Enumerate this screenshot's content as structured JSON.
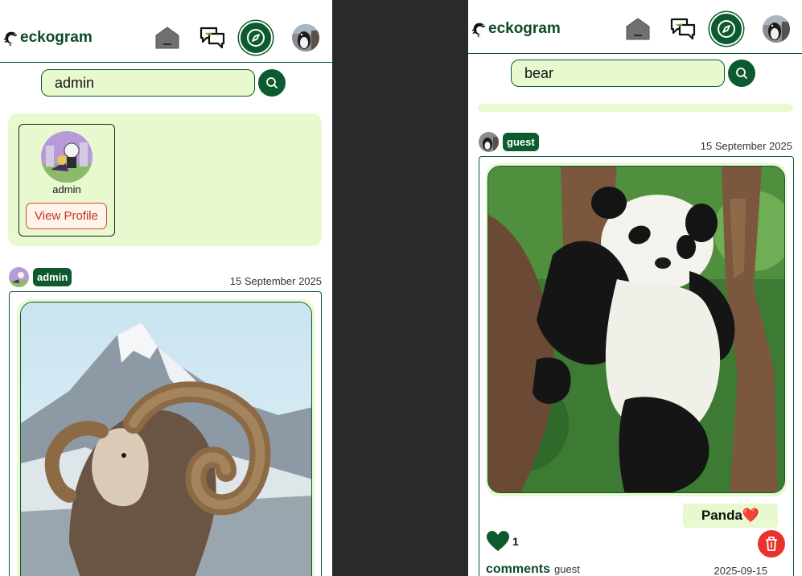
{
  "left": {
    "logo": "eckogram",
    "search": {
      "value": "admin"
    },
    "result_card": {
      "username": "admin",
      "button_label": "View Profile"
    },
    "post": {
      "username": "admin",
      "date": "15 September 2025"
    }
  },
  "right": {
    "logo": "eckogram",
    "search": {
      "value": "bear"
    },
    "post": {
      "username": "guest",
      "date": "15 September 2025",
      "caption": "Panda",
      "caption_emoji": "❤️",
      "like_count": "1",
      "comments_label": "comments",
      "comments_user": "guest",
      "comments_date": "2025-09-15"
    }
  },
  "colors": {
    "brand_green": "#0d5a2f",
    "light_green": "#e8f9cf",
    "delete_red": "#e8332d",
    "profile_red": "#d9442f"
  },
  "icons": [
    "gecko-logo-icon",
    "home-icon",
    "chat-icon",
    "compass-icon",
    "search-icon",
    "heart-icon",
    "trash-icon"
  ]
}
